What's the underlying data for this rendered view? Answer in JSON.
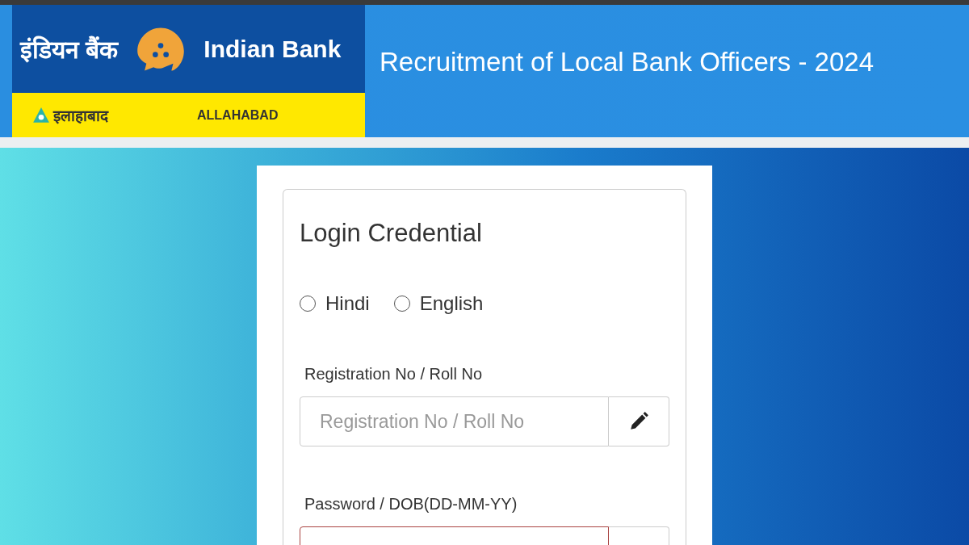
{
  "header": {
    "logo": {
      "hindi_name": "इंडियन बैंक",
      "english_name": "Indian Bank",
      "hindi_sub": "इलाहाबाद",
      "english_sub": "ALLAHABAD"
    },
    "title": "Recruitment of Local Bank Officers - 2024"
  },
  "login": {
    "title": "Login Credential",
    "languages": [
      {
        "label": "Hindi",
        "selected": false
      },
      {
        "label": "English",
        "selected": false
      }
    ],
    "fields": [
      {
        "label": "Registration No / Roll No",
        "placeholder": "Registration No / Roll No",
        "invalid": false
      },
      {
        "label": "Password / DOB(DD-MM-YY)",
        "invalid": true
      }
    ]
  }
}
